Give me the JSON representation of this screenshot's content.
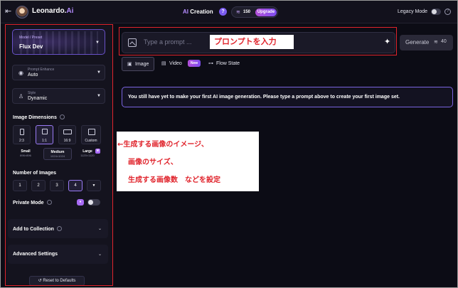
{
  "app": {
    "logo_text": "Leonardo.",
    "logo_suffix": "Ai",
    "mode_prefix": "AI",
    "mode_title": "Creation",
    "help_mark": "?",
    "tokens": "150",
    "upgrade_label": "Upgrade",
    "legacy_mode_label": "Legacy Mode",
    "legacy_mode_on": false
  },
  "sidebar": {
    "preset_label": "Model / Preset",
    "preset_value": "Flux Dev",
    "prompt_enhance_label": "Prompt Enhance",
    "prompt_enhance_value": "Auto",
    "style_label": "Style",
    "style_value": "Dynamic",
    "image_dimensions_title": "Image Dimensions",
    "ratios": [
      {
        "label": "2:3",
        "selected": false
      },
      {
        "label": "1:1",
        "selected": true
      },
      {
        "label": "16:9",
        "selected": false
      },
      {
        "label": "Custom",
        "selected": false
      }
    ],
    "sizes": [
      {
        "name": "Small",
        "dims": "896×896",
        "selected": false
      },
      {
        "name": "Medium",
        "dims": "1024×1024",
        "selected": true
      },
      {
        "name": "Large",
        "dims": "1120×1120",
        "selected": false
      }
    ],
    "number_of_images_title": "Number of Images",
    "image_counts": [
      "1",
      "2",
      "3",
      "4"
    ],
    "selected_count": "4",
    "private_mode_label": "Private Mode",
    "private_mode_on": false,
    "add_to_collection_label": "Add to Collection",
    "advanced_settings_label": "Advanced Settings",
    "reset_label": "Reset to Defaults"
  },
  "main": {
    "prompt_placeholder": "Type a prompt ...",
    "generate_label": "Generate",
    "generate_cost": "40",
    "tabs": [
      {
        "label": "Image",
        "selected": true,
        "icon": "image-icon"
      },
      {
        "label": "Video",
        "selected": false,
        "icon": "video-icon",
        "badge": "New"
      },
      {
        "label": "Flow State",
        "selected": false,
        "icon": "link-icon"
      }
    ],
    "empty_message": "You still have yet to make your first AI image generation. Please type a prompt above to create your first image set."
  },
  "annotations": {
    "prompt_note": "プロンプトを入力",
    "sidebar_note_lines": [
      "←生成する画像のイメージ、",
      "画像のサイズ、",
      "生成する画像数　などを設定"
    ]
  },
  "colors": {
    "accent": "#7b5cf0",
    "annotation_red": "#e0242c",
    "background": "#0c0c15"
  }
}
